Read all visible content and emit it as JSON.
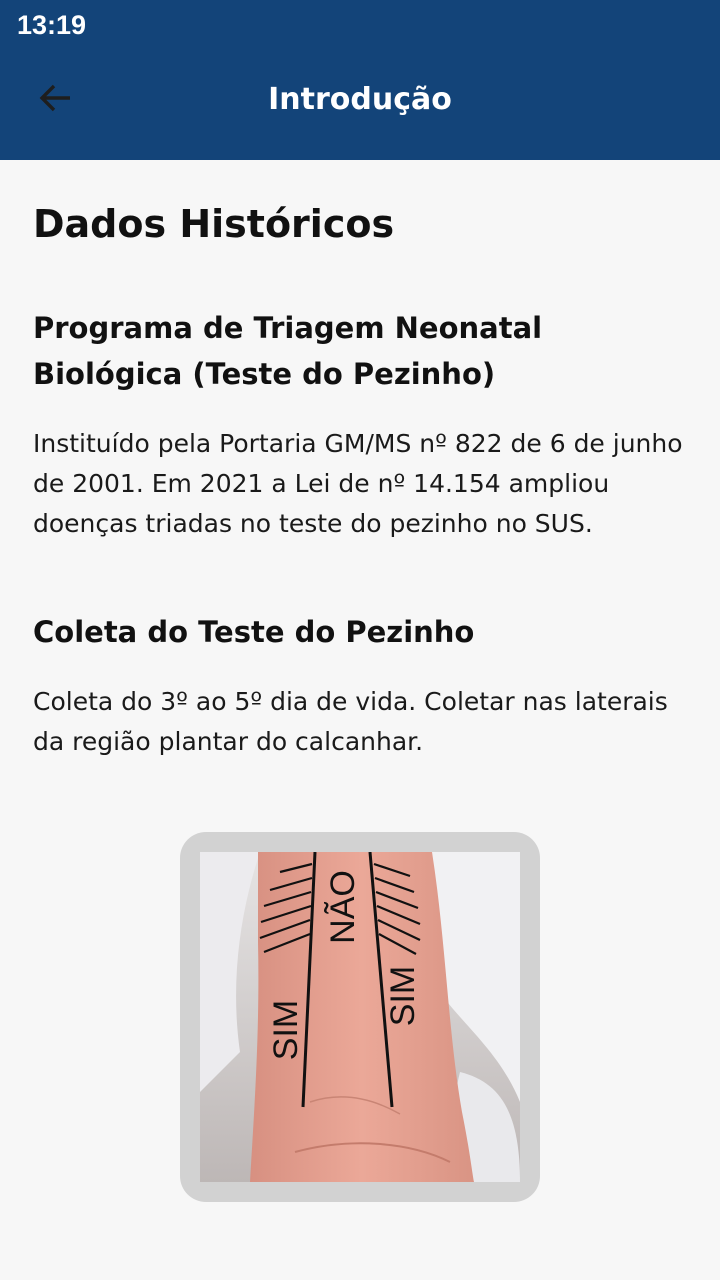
{
  "status": {
    "time": "13:19"
  },
  "appbar": {
    "title": "Introdução",
    "back_icon": "arrow-left-icon"
  },
  "content": {
    "title": "Dados Históricos",
    "sections": [
      {
        "heading": "Programa de Triagem Neonatal Biológica (Teste do Pezinho)",
        "text": "Instituído pela Portaria GM/MS nº 822 de 6 de junho de 2001. Em 2021 a Lei de nº 14.154 ampliou doenças triadas no teste do pezinho no SUS."
      },
      {
        "heading": "Coleta do Teste do Pezinho",
        "text": "Coleta do 3º ao 5º dia de vida. Coletar nas laterais da região plantar do calcanhar."
      }
    ],
    "figure": {
      "labels": {
        "left": "SIM",
        "center": "NÃO",
        "right": "SIM"
      }
    }
  },
  "colors": {
    "primary": "#134479",
    "background": "#f7f7f7",
    "frame": "#d2d2d2"
  }
}
